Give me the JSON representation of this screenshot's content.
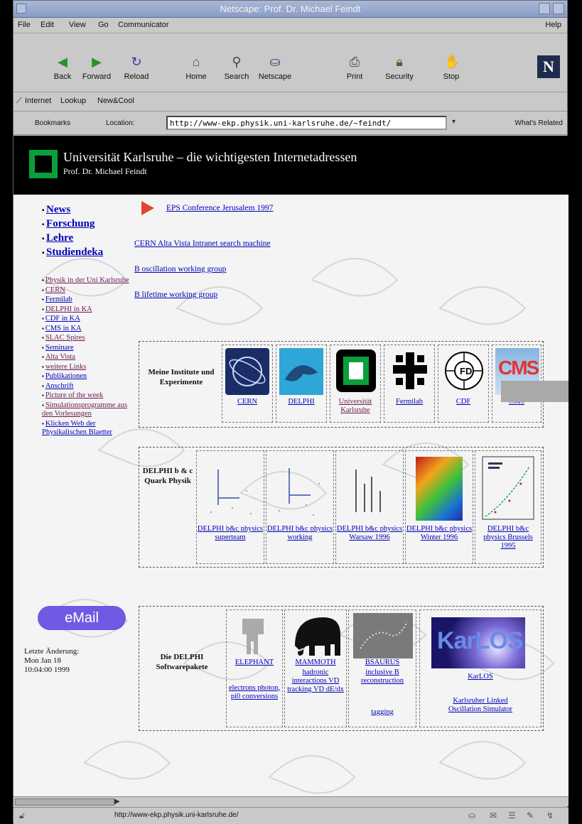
{
  "window": {
    "title": "Netscape: Prof. Dr. Michael Feindt"
  },
  "menu": [
    "File",
    "Edit",
    "View",
    "Go",
    "Communicator"
  ],
  "menu_help": "Help",
  "toolbar": [
    {
      "label": "Back",
      "icon": "back-arrow-icon"
    },
    {
      "label": "Forward",
      "icon": "forward-arrow-icon"
    },
    {
      "label": "Reload",
      "icon": "reload-icon"
    },
    {
      "label": "Home",
      "icon": "home-icon"
    },
    {
      "label": "Search",
      "icon": "search-icon"
    },
    {
      "label": "Netscape",
      "icon": "netscape-icon"
    },
    {
      "label": "Print",
      "icon": "print-icon"
    },
    {
      "label": "Security",
      "icon": "security-lock-icon"
    },
    {
      "label": "Stop",
      "icon": "stop-icon"
    }
  ],
  "personal_toolbar": [
    "Internet",
    "Lookup",
    "New&Cool"
  ],
  "location": {
    "bookmarks_label": "Bookmarks",
    "location_label": "Location:",
    "url": "http://www-ekp.physik.uni-karlsruhe.de/~feindt/",
    "whats_related": "What's Related"
  },
  "banner": {
    "title": "Universität Karlsruhe – die wichtigesten Internetadressen",
    "subtitle": "Prof. Dr. Michael Feindt"
  },
  "nav": [
    "News",
    "Forschung",
    "Lehre",
    "Studiendeka"
  ],
  "side_links": [
    "Physik in der Uni Karlsruhe",
    "CERN",
    "Fermilab",
    "DELPHI in KA",
    "CDF in KA",
    "CMS in KA",
    "SLAC Spires",
    "Seminare",
    "Alta Vista",
    "weitere Links",
    "Publikationen",
    "Anschrift",
    "Picture of the week",
    "Simulationsprogramme aus den Vorlesungen",
    "Klicken Web der Physikalischen Blaetter"
  ],
  "email_button": "eMail",
  "lastmod": [
    "Letzte Änderung:",
    "Mon Jan 18",
    "10:04:00 1999"
  ],
  "top_links": [
    "EPS Conference Jerusalem 1997",
    "CERN Alta Vista Intranet search machine",
    "B oscillation working group",
    "B lifetime working group"
  ],
  "institutes": {
    "label": "Meine Institute und Experimente",
    "items": [
      "CERN",
      "DELPHI",
      "Universität Karlsruhe",
      "Fermilab",
      "CDF",
      "CMS"
    ]
  },
  "delphi_physics": {
    "label": "DELPHI b & c Quark Physik",
    "items": [
      "DELPHI b&c physics superteam",
      "DELPHI b&c physics working",
      "DELPHI b&c physics Warsaw 1996",
      "DELPHI b&c physics Winter 1996",
      "DELPHI b&c physics Brussels 1995"
    ]
  },
  "software": {
    "label": "Die DELPHI Softwarepakete",
    "items": [
      {
        "name": "ELEPHANT",
        "desc": "electrons photon, pi0 conversions"
      },
      {
        "name": "MAMMOTH",
        "desc": "hadronic interactions VD tracking VD dE/dx"
      },
      {
        "name": "BSAURUS",
        "desc": "inclusive B reconstruction",
        "extra": "tagging"
      },
      {
        "name": "KarLOS",
        "desc": "Karlsruher Linked Oscillation Simulator",
        "logo_text": "KarLOS"
      }
    ]
  },
  "status": "http://www-ekp.physik.uni-karlsruhe.de/",
  "colors": {
    "banner": "#000000",
    "uni_green": "#0a9e3c",
    "link": "#0000b8",
    "email": "#7259e3"
  }
}
